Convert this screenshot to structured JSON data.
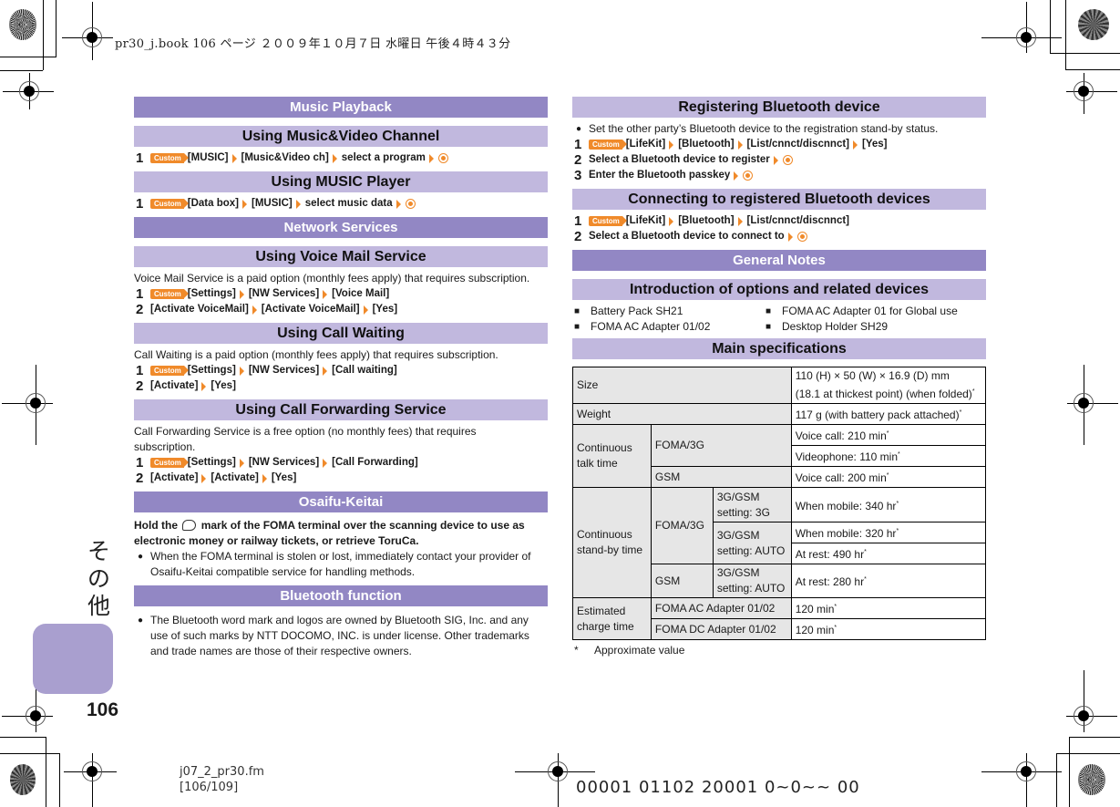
{
  "header": {
    "print_info": "pr30_j.book  106 ページ  ２００９年１０月７日  水曜日  午後４時４３分"
  },
  "keys": {
    "custom": "Custom"
  },
  "left": {
    "music": {
      "title": "Music Playback",
      "mv_channel": {
        "title": "Using Music&Video Channel",
        "steps": [
          {
            "num": "1",
            "parts": [
              "[MUSIC]",
              "[Music&Video ch]",
              "select a program"
            ]
          }
        ]
      },
      "player": {
        "title": "Using MUSIC Player",
        "steps": [
          {
            "num": "1",
            "parts": [
              "[Data box]",
              "[MUSIC]",
              "select music data"
            ]
          }
        ]
      }
    },
    "network": {
      "title": "Network Services",
      "voicemail": {
        "title": "Using Voice Mail Service",
        "desc": "Voice Mail Service is a paid option (monthly fees apply) that requires subscription.",
        "step1": {
          "num": "1",
          "parts": [
            "[Settings]",
            "[NW Services]",
            "[Voice Mail]"
          ]
        },
        "step2": {
          "num": "2",
          "parts": [
            "[Activate VoiceMail]",
            "[Activate VoiceMail]",
            "[Yes]"
          ]
        }
      },
      "callwaiting": {
        "title": "Using Call Waiting",
        "desc": "Call Waiting is a paid option (monthly fees apply) that requires subscription.",
        "step1": {
          "num": "1",
          "parts": [
            "[Settings]",
            "[NW Services]",
            "[Call waiting]"
          ]
        },
        "step2": {
          "num": "2",
          "parts": [
            "[Activate]",
            "[Yes]"
          ]
        }
      },
      "forwarding": {
        "title": "Using Call Forwarding Service",
        "desc": "Call Forwarding Service is a free option (no monthly fees) that requires subscription.",
        "step1": {
          "num": "1",
          "parts": [
            "[Settings]",
            "[NW Services]",
            "[Call Forwarding]"
          ]
        },
        "step2": {
          "num": "2",
          "parts": [
            "[Activate]",
            "[Activate]",
            "[Yes]"
          ]
        }
      }
    },
    "osaifu": {
      "title": "Osaifu-Keitai",
      "lead_before": "Hold the",
      "lead_after": "mark of the FOMA terminal over the scanning device to use as electronic money or railway tickets, or retrieve ToruCa.",
      "bullet": "When the FOMA terminal is stolen or lost, immediately contact your provider of Osaifu-Keitai compatible service for handling methods."
    },
    "bluetooth": {
      "title": "Bluetooth function",
      "bullet": "The Bluetooth word mark and logos are owned by Bluetooth SIG, Inc. and any use of such marks by NTT DOCOMO, INC. is under license. Other trademarks and trade names are those of their respective owners."
    }
  },
  "right": {
    "register": {
      "title": "Registering Bluetooth device",
      "bullet": "Set the other party’s Bluetooth device to the registration stand-by status.",
      "step1": {
        "num": "1",
        "parts": [
          "[LifeKit]",
          "[Bluetooth]",
          "[List/cnnct/discnnct]",
          "[Yes]"
        ]
      },
      "step2": {
        "num": "2",
        "text": "Select a Bluetooth device to register"
      },
      "step3": {
        "num": "3",
        "text": "Enter the Bluetooth passkey"
      }
    },
    "connect": {
      "title": "Connecting to registered Bluetooth devices",
      "step1": {
        "num": "1",
        "parts": [
          "[LifeKit]",
          "[Bluetooth]",
          "[List/cnnct/discnnct]"
        ]
      },
      "step2": {
        "num": "2",
        "text": "Select a Bluetooth device to connect to"
      }
    },
    "general": {
      "title": "General Notes",
      "options_title": "Introduction of options and related devices",
      "options": [
        "Battery Pack SH21",
        "FOMA AC Adapter 01 for Global use",
        "FOMA AC Adapter 01/02",
        "Desktop Holder SH29"
      ],
      "specs_title": "Main specifications",
      "specs": {
        "size_label": "Size",
        "size_value_1": "110 (H) × 50 (W) × 16.9 (D) mm",
        "size_value_2": "(18.1 at thickest point) (when folded)",
        "weight_label": "Weight",
        "weight_value": "117 g (with battery pack attached)",
        "talk_label": "Continuous talk time",
        "talk_foma": "FOMA/3G",
        "talk_foma_voice": "Voice call: 210 min",
        "talk_foma_video": "Videophone: 110 min",
        "talk_gsm": "GSM",
        "talk_gsm_voice": "Voice call: 200 min",
        "standby_label": "Continuous stand-by time",
        "standby_foma": "FOMA/3G",
        "standby_setting_3g": "3G/GSM setting: 3G",
        "standby_3g_mobile": "When mobile: 340 hr",
        "standby_setting_auto": "3G/GSM setting: AUTO",
        "standby_auto_mobile": "When mobile: 320 hr",
        "standby_auto_rest": "At rest: 490 hr",
        "standby_gsm": "GSM",
        "standby_gsm_setting": "3G/GSM setting: AUTO",
        "standby_gsm_rest": "At rest: 280 hr",
        "charge_label": "Estimated charge time",
        "charge_ac": "FOMA AC Adapter 01/02",
        "charge_ac_value": "120 min",
        "charge_dc": "FOMA DC Adapter 01/02",
        "charge_dc_value": "120 min",
        "asterisk": "*"
      },
      "footnote_mark": "*",
      "footnote": "Approximate value"
    }
  },
  "sidebar": {
    "section_jp": "その他",
    "page_number": "106"
  },
  "footer": {
    "file_name": "j07_2_pr30.fm",
    "page_range": "[106/109]",
    "code": "00001 01102 20001 0~0~~ 00"
  }
}
